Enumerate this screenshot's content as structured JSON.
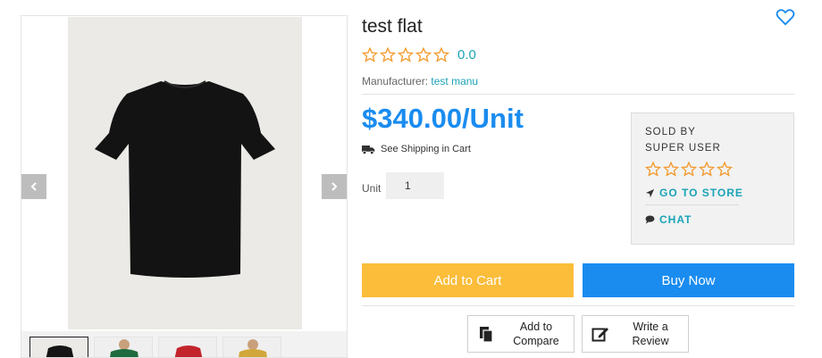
{
  "product": {
    "title": "test flat",
    "rating_value": "0.0",
    "manufacturer_label": "Manufacturer:",
    "manufacturer_name": "test manu",
    "price": "$340.00/Unit",
    "shipping_text": "See Shipping in Cart",
    "unit_label": "Unit",
    "quantity": "1"
  },
  "seller": {
    "sold_by": "SOLD BY",
    "name": "SUPER USER",
    "go_to_store": "GO TO STORE",
    "chat": "CHAT"
  },
  "actions": {
    "add_to_cart": "Add to Cart",
    "buy_now": "Buy Now",
    "add_to_compare": "Add to Compare",
    "write_review": "Write a Review"
  },
  "gallery": {
    "thumbnails": [
      "black",
      "green",
      "red",
      "mustard"
    ]
  },
  "colors": {
    "accent_blue": "#1a8cf0",
    "accent_orange": "#fbbd3a",
    "link_teal": "#1aa3b7",
    "star_orange": "#f39a2e"
  },
  "icons": {
    "wishlist": "heart-icon",
    "prev": "chevron-left-icon",
    "next": "chevron-right-icon",
    "shipping": "truck-icon",
    "store": "location-arrow-icon",
    "chat": "chat-bubble-icon",
    "compare": "copy-icon",
    "review": "edit-icon"
  }
}
